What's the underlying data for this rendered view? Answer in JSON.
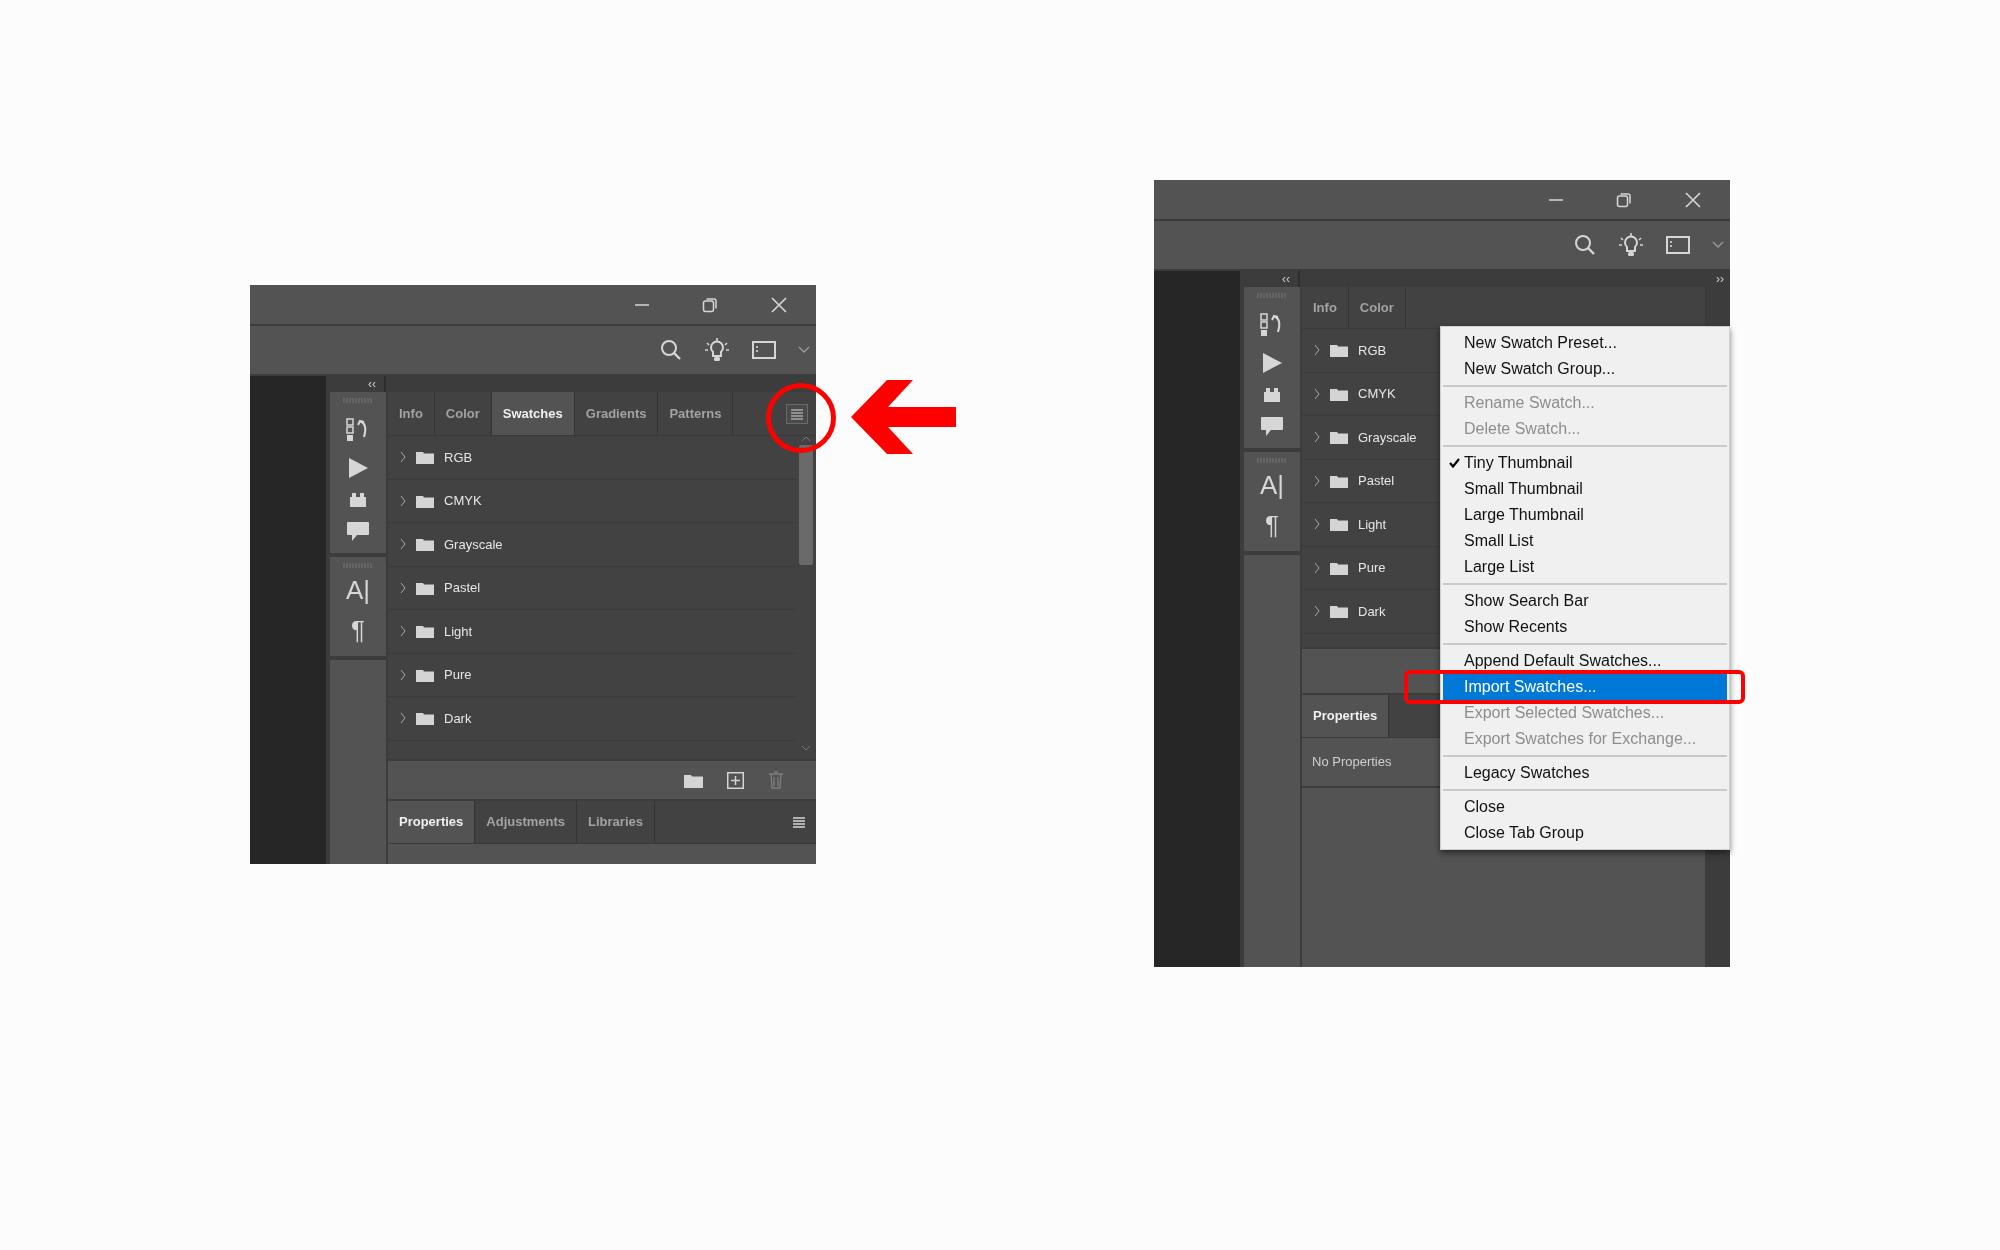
{
  "left_screenshot": {
    "collapse_glyph": "‹‹",
    "panel_tabs": [
      {
        "label": "Info",
        "selected": false
      },
      {
        "label": "Color",
        "selected": false
      },
      {
        "label": "Swatches",
        "selected": true
      },
      {
        "label": "Gradients",
        "selected": false
      },
      {
        "label": "Patterns",
        "selected": false
      }
    ],
    "tool_glyphs": [
      "A|",
      "¶"
    ],
    "swatch_groups": [
      {
        "label": "RGB",
        "expanded": false
      },
      {
        "label": "CMYK",
        "expanded": false
      },
      {
        "label": "Grayscale",
        "expanded": false
      },
      {
        "label": "Pastel",
        "expanded": false
      },
      {
        "label": "Light",
        "expanded": false
      },
      {
        "label": "Pure",
        "expanded": false
      },
      {
        "label": "Dark",
        "expanded": false
      }
    ],
    "bottom_tabs": [
      {
        "label": "Properties",
        "selected": true
      },
      {
        "label": "Adjustments",
        "selected": false
      },
      {
        "label": "Libraries",
        "selected": false
      }
    ]
  },
  "right_screenshot": {
    "collapse_glyph": "‹‹",
    "expand_glyph": "››",
    "panel_tabs": [
      {
        "label": "Info",
        "selected": false
      },
      {
        "label": "Color",
        "selected": false
      }
    ],
    "tool_glyphs": [
      "A|",
      "¶"
    ],
    "swatch_groups": [
      {
        "label": "RGB",
        "expanded": false
      },
      {
        "label": "CMYK",
        "expanded": false
      },
      {
        "label": "Grayscale",
        "expanded": false
      },
      {
        "label": "Pastel",
        "expanded": false
      },
      {
        "label": "Light",
        "expanded": false
      },
      {
        "label": "Pure",
        "expanded": false
      },
      {
        "label": "Dark",
        "expanded": false
      }
    ],
    "bottom_tabs": [
      {
        "label": "Properties",
        "selected": true
      }
    ],
    "properties_text": "No Properties",
    "menu": [
      {
        "kind": "item",
        "label": "New Swatch Preset...",
        "disabled": false,
        "checked": false,
        "selected": false
      },
      {
        "kind": "item",
        "label": "New Swatch Group...",
        "disabled": false,
        "checked": false,
        "selected": false
      },
      {
        "kind": "separator"
      },
      {
        "kind": "item",
        "label": "Rename Swatch...",
        "disabled": true,
        "checked": false,
        "selected": false
      },
      {
        "kind": "item",
        "label": "Delete Swatch...",
        "disabled": true,
        "checked": false,
        "selected": false
      },
      {
        "kind": "separator"
      },
      {
        "kind": "item",
        "label": "Tiny Thumbnail",
        "disabled": false,
        "checked": true,
        "selected": false
      },
      {
        "kind": "item",
        "label": "Small Thumbnail",
        "disabled": false,
        "checked": false,
        "selected": false
      },
      {
        "kind": "item",
        "label": "Large Thumbnail",
        "disabled": false,
        "checked": false,
        "selected": false
      },
      {
        "kind": "item",
        "label": "Small List",
        "disabled": false,
        "checked": false,
        "selected": false
      },
      {
        "kind": "item",
        "label": "Large List",
        "disabled": false,
        "checked": false,
        "selected": false
      },
      {
        "kind": "separator"
      },
      {
        "kind": "item",
        "label": "Show Search Bar",
        "disabled": false,
        "checked": false,
        "selected": false
      },
      {
        "kind": "item",
        "label": "Show Recents",
        "disabled": false,
        "checked": false,
        "selected": false
      },
      {
        "kind": "separator"
      },
      {
        "kind": "item",
        "label": "Append Default Swatches...",
        "disabled": false,
        "checked": false,
        "selected": false
      },
      {
        "kind": "item",
        "label": "Import Swatches...",
        "disabled": false,
        "checked": false,
        "selected": true
      },
      {
        "kind": "item",
        "label": "Export Selected Swatches...",
        "disabled": true,
        "checked": false,
        "selected": false
      },
      {
        "kind": "item",
        "label": "Export Swatches for Exchange...",
        "disabled": true,
        "checked": false,
        "selected": false
      },
      {
        "kind": "separator"
      },
      {
        "kind": "item",
        "label": "Legacy Swatches",
        "disabled": false,
        "checked": false,
        "selected": false
      },
      {
        "kind": "separator"
      },
      {
        "kind": "item",
        "label": "Close",
        "disabled": false,
        "checked": false,
        "selected": false
      },
      {
        "kind": "item",
        "label": "Close Tab Group",
        "disabled": false,
        "checked": false,
        "selected": false
      }
    ]
  }
}
